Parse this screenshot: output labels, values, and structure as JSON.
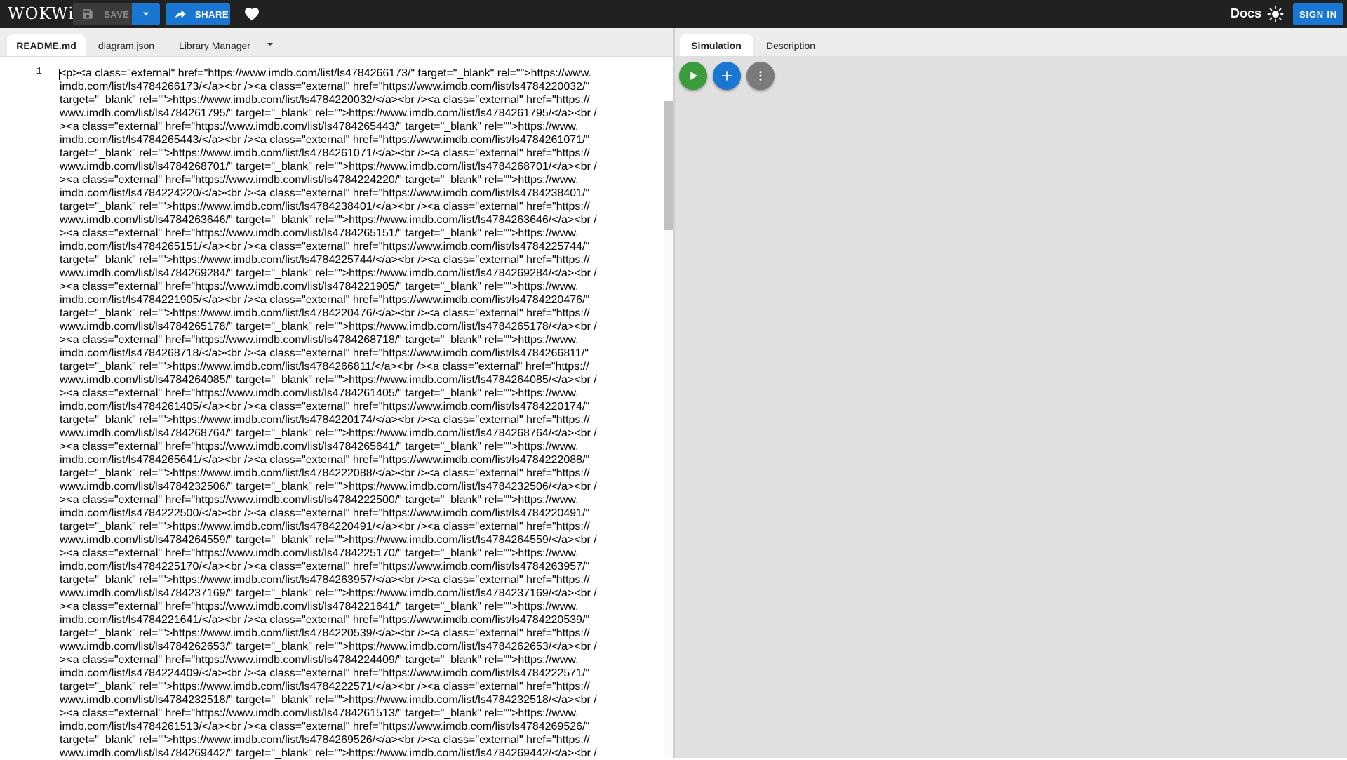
{
  "app": {
    "logo_text": "WOKWi"
  },
  "toolbar": {
    "save_label": "SAVE",
    "share_label": "SHARE",
    "docs_label": "Docs",
    "signin_label": "SIGN IN"
  },
  "editor": {
    "tabs": [
      {
        "label": "README.md",
        "active": true
      },
      {
        "label": "diagram.json",
        "active": false
      },
      {
        "label": "Library Manager",
        "active": false
      }
    ],
    "line_number": "1",
    "code_lines": [
      "<p><a class=\"external\" href=\"https://www.imdb.com/list/ls4784266173/\" target=\"_blank\" rel=\"\">https://www.",
      "imdb.com/list/ls4784266173/</a><br /><a class=\"external\" href=\"https://www.imdb.com/list/ls4784220032/\"",
      "target=\"_blank\" rel=\"\">https://www.imdb.com/list/ls4784220032/</a><br /><a class=\"external\" href=\"https://",
      "www.imdb.com/list/ls4784261795/\" target=\"_blank\" rel=\"\">https://www.imdb.com/list/ls4784261795/</a><br /",
      "><a class=\"external\" href=\"https://www.imdb.com/list/ls4784265443/\" target=\"_blank\" rel=\"\">https://www.",
      "imdb.com/list/ls4784265443/</a><br /><a class=\"external\" href=\"https://www.imdb.com/list/ls4784261071/\"",
      "target=\"_blank\" rel=\"\">https://www.imdb.com/list/ls4784261071/</a><br /><a class=\"external\" href=\"https://",
      "www.imdb.com/list/ls4784268701/\" target=\"_blank\" rel=\"\">https://www.imdb.com/list/ls4784268701/</a><br /",
      "><a class=\"external\" href=\"https://www.imdb.com/list/ls4784224220/\" target=\"_blank\" rel=\"\">https://www.",
      "imdb.com/list/ls4784224220/</a><br /><a class=\"external\" href=\"https://www.imdb.com/list/ls4784238401/\"",
      "target=\"_blank\" rel=\"\">https://www.imdb.com/list/ls4784238401/</a><br /><a class=\"external\" href=\"https://",
      "www.imdb.com/list/ls4784263646/\" target=\"_blank\" rel=\"\">https://www.imdb.com/list/ls4784263646/</a><br /",
      "><a class=\"external\" href=\"https://www.imdb.com/list/ls4784265151/\" target=\"_blank\" rel=\"\">https://www.",
      "imdb.com/list/ls4784265151/</a><br /><a class=\"external\" href=\"https://www.imdb.com/list/ls4784225744/\"",
      "target=\"_blank\" rel=\"\">https://www.imdb.com/list/ls4784225744/</a><br /><a class=\"external\" href=\"https://",
      "www.imdb.com/list/ls4784269284/\" target=\"_blank\" rel=\"\">https://www.imdb.com/list/ls4784269284/</a><br /",
      "><a class=\"external\" href=\"https://www.imdb.com/list/ls4784221905/\" target=\"_blank\" rel=\"\">https://www.",
      "imdb.com/list/ls4784221905/</a><br /><a class=\"external\" href=\"https://www.imdb.com/list/ls4784220476/\"",
      "target=\"_blank\" rel=\"\">https://www.imdb.com/list/ls4784220476/</a><br /><a class=\"external\" href=\"https://",
      "www.imdb.com/list/ls4784265178/\" target=\"_blank\" rel=\"\">https://www.imdb.com/list/ls4784265178/</a><br /",
      "><a class=\"external\" href=\"https://www.imdb.com/list/ls4784268718/\" target=\"_blank\" rel=\"\">https://www.",
      "imdb.com/list/ls4784268718/</a><br /><a class=\"external\" href=\"https://www.imdb.com/list/ls4784266811/\"",
      "target=\"_blank\" rel=\"\">https://www.imdb.com/list/ls4784266811/</a><br /><a class=\"external\" href=\"https://",
      "www.imdb.com/list/ls4784264085/\" target=\"_blank\" rel=\"\">https://www.imdb.com/list/ls4784264085/</a><br /",
      "><a class=\"external\" href=\"https://www.imdb.com/list/ls4784261405/\" target=\"_blank\" rel=\"\">https://www.",
      "imdb.com/list/ls4784261405/</a><br /><a class=\"external\" href=\"https://www.imdb.com/list/ls4784220174/\"",
      "target=\"_blank\" rel=\"\">https://www.imdb.com/list/ls4784220174/</a><br /><a class=\"external\" href=\"https://",
      "www.imdb.com/list/ls4784268764/\" target=\"_blank\" rel=\"\">https://www.imdb.com/list/ls4784268764/</a><br /",
      "><a class=\"external\" href=\"https://www.imdb.com/list/ls4784265641/\" target=\"_blank\" rel=\"\">https://www.",
      "imdb.com/list/ls4784265641/</a><br /><a class=\"external\" href=\"https://www.imdb.com/list/ls4784222088/\"",
      "target=\"_blank\" rel=\"\">https://www.imdb.com/list/ls4784222088/</a><br /><a class=\"external\" href=\"https://",
      "www.imdb.com/list/ls4784232506/\" target=\"_blank\" rel=\"\">https://www.imdb.com/list/ls4784232506/</a><br /",
      "><a class=\"external\" href=\"https://www.imdb.com/list/ls4784222500/\" target=\"_blank\" rel=\"\">https://www.",
      "imdb.com/list/ls4784222500/</a><br /><a class=\"external\" href=\"https://www.imdb.com/list/ls4784220491/\"",
      "target=\"_blank\" rel=\"\">https://www.imdb.com/list/ls4784220491/</a><br /><a class=\"external\" href=\"https://",
      "www.imdb.com/list/ls4784264559/\" target=\"_blank\" rel=\"\">https://www.imdb.com/list/ls4784264559/</a><br /",
      "><a class=\"external\" href=\"https://www.imdb.com/list/ls4784225170/\" target=\"_blank\" rel=\"\">https://www.",
      "imdb.com/list/ls4784225170/</a><br /><a class=\"external\" href=\"https://www.imdb.com/list/ls4784263957/\"",
      "target=\"_blank\" rel=\"\">https://www.imdb.com/list/ls4784263957/</a><br /><a class=\"external\" href=\"https://",
      "www.imdb.com/list/ls4784237169/\" target=\"_blank\" rel=\"\">https://www.imdb.com/list/ls4784237169/</a><br /",
      "><a class=\"external\" href=\"https://www.imdb.com/list/ls4784221641/\" target=\"_blank\" rel=\"\">https://www.",
      "imdb.com/list/ls4784221641/</a><br /><a class=\"external\" href=\"https://www.imdb.com/list/ls4784220539/\"",
      "target=\"_blank\" rel=\"\">https://www.imdb.com/list/ls4784220539/</a><br /><a class=\"external\" href=\"https://",
      "www.imdb.com/list/ls4784262653/\" target=\"_blank\" rel=\"\">https://www.imdb.com/list/ls4784262653/</a><br /",
      "><a class=\"external\" href=\"https://www.imdb.com/list/ls4784224409/\" target=\"_blank\" rel=\"\">https://www.",
      "imdb.com/list/ls4784224409/</a><br /><a class=\"external\" href=\"https://www.imdb.com/list/ls4784222571/\"",
      "target=\"_blank\" rel=\"\">https://www.imdb.com/list/ls4784222571/</a><br /><a class=\"external\" href=\"https://",
      "www.imdb.com/list/ls4784232518/\" target=\"_blank\" rel=\"\">https://www.imdb.com/list/ls4784232518/</a><br /",
      "><a class=\"external\" href=\"https://www.imdb.com/list/ls4784261513/\" target=\"_blank\" rel=\"\">https://www.",
      "imdb.com/list/ls4784261513/</a><br /><a class=\"external\" href=\"https://www.imdb.com/list/ls4784269526/\"",
      "target=\"_blank\" rel=\"\">https://www.imdb.com/list/ls4784269526/</a><br /><a class=\"external\" href=\"https://",
      "www.imdb.com/list/ls4784269442/\" target=\"_blank\" rel=\"\">https://www.imdb.com/list/ls4784269442/</a><br /"
    ]
  },
  "simulation": {
    "tabs": [
      {
        "label": "Simulation",
        "active": true
      },
      {
        "label": "Description",
        "active": false
      }
    ],
    "buttons": {
      "play": "play-icon",
      "add": "plus-icon",
      "more": "more-vertical-icon"
    }
  },
  "icons": {
    "save": "save-icon",
    "dropdown": "chevron-down-icon",
    "share": "share-arrow-icon",
    "heart": "heart-icon",
    "theme": "sun-icon"
  },
  "colors": {
    "topbar": "#212121",
    "primary": "#1976d2",
    "play": "#3a9c3c",
    "more": "#7a7a7a"
  }
}
